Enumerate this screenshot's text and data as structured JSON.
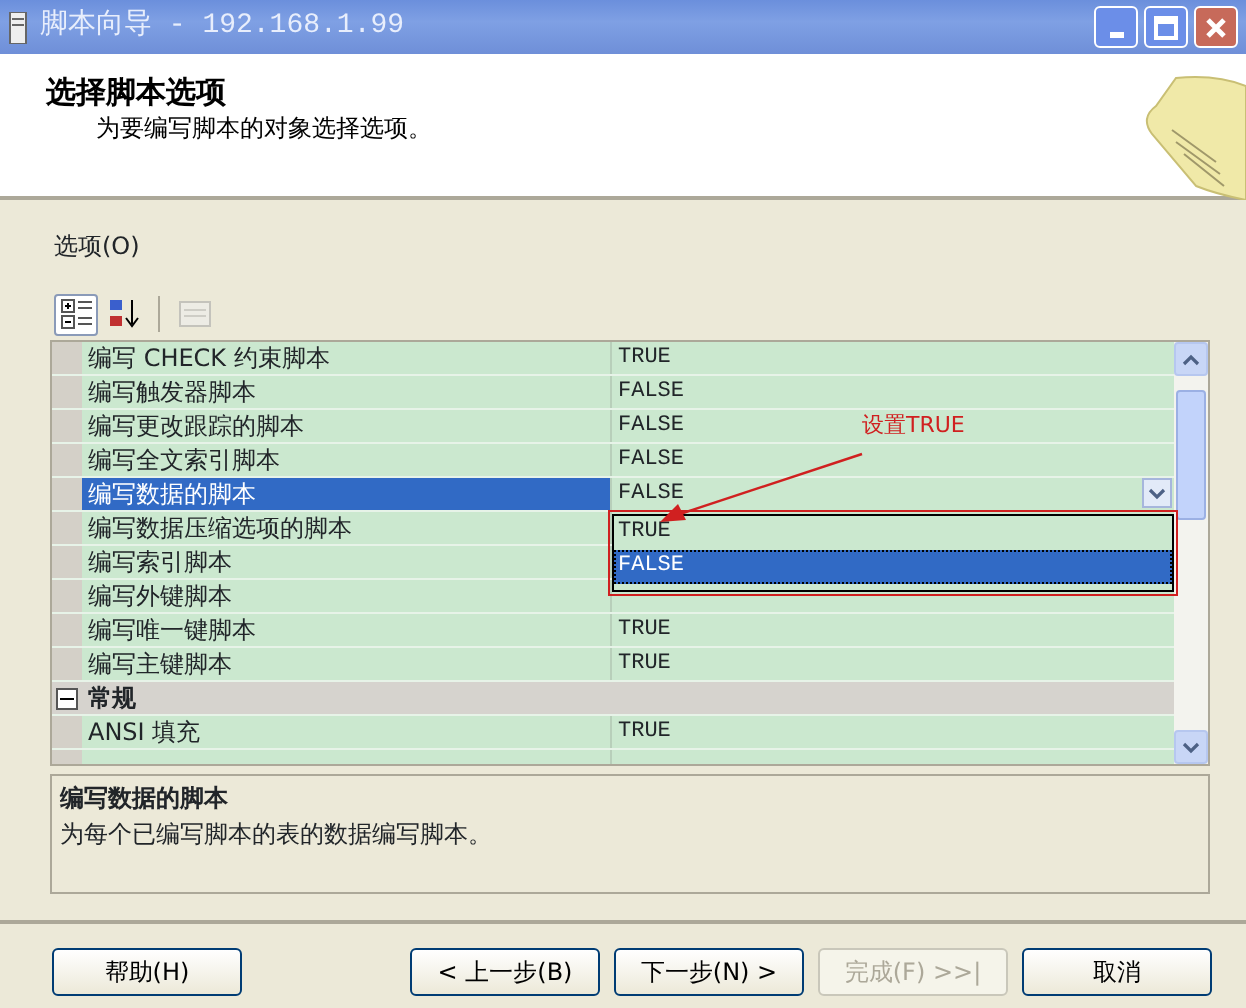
{
  "window": {
    "title": "脚本向导 - 192.168.1.99"
  },
  "header": {
    "title": "选择脚本选项",
    "subtitle": "为要编写脚本的对象选择选项。"
  },
  "options_label": "选项(O)",
  "toolbar": [
    {
      "kind": "categorized",
      "selected": true,
      "disabled": false
    },
    {
      "kind": "alphabetical",
      "selected": false,
      "disabled": false
    },
    {
      "kind": "pages",
      "selected": false,
      "disabled": true
    }
  ],
  "grid": {
    "rows": [
      {
        "kind": "property",
        "name": "编写 CHECK 约束脚本",
        "value": "TRUE",
        "selected": false
      },
      {
        "kind": "property",
        "name": "编写触发器脚本",
        "value": "FALSE",
        "selected": false
      },
      {
        "kind": "property",
        "name": "编写更改跟踪的脚本",
        "value": "FALSE",
        "selected": false
      },
      {
        "kind": "property",
        "name": "编写全文索引脚本",
        "value": "FALSE",
        "selected": false
      },
      {
        "kind": "property",
        "name": "编写数据的脚本",
        "value": "FALSE",
        "selected": true
      },
      {
        "kind": "property",
        "name": "编写数据压缩选项的脚本",
        "selected": false
      },
      {
        "kind": "property",
        "name": "编写索引脚本",
        "selected": false
      },
      {
        "kind": "property",
        "name": "编写外键脚本",
        "selected": false
      },
      {
        "kind": "property",
        "name": "编写唯一键脚本",
        "value": "TRUE",
        "selected": false
      },
      {
        "kind": "property",
        "name": "编写主键脚本",
        "value": "TRUE",
        "selected": false
      },
      {
        "kind": "category",
        "name": "常规",
        "expanded": true
      },
      {
        "kind": "property",
        "name": "ANSI 填充",
        "value": "TRUE",
        "selected": false
      },
      {
        "kind": "property",
        "selected": false
      }
    ],
    "dropdown": {
      "options": [
        {
          "label": "TRUE",
          "selected": false
        },
        {
          "label": "FALSE",
          "selected": true
        }
      ]
    },
    "annotation": "设置TRUE"
  },
  "description": {
    "title": "编写数据的脚本",
    "text": "为每个已编写脚本的表的数据编写脚本。"
  },
  "buttons": [
    {
      "kind": "help",
      "label": "帮助(H)",
      "disabled": false
    },
    {
      "kind": "back",
      "label": "< 上一步(B)",
      "disabled": false
    },
    {
      "kind": "next",
      "label": "下一步(N) >",
      "disabled": false
    },
    {
      "kind": "finish",
      "label": "完成(F) >>|",
      "disabled": true
    },
    {
      "kind": "cancel",
      "label": "取消",
      "disabled": false
    }
  ]
}
